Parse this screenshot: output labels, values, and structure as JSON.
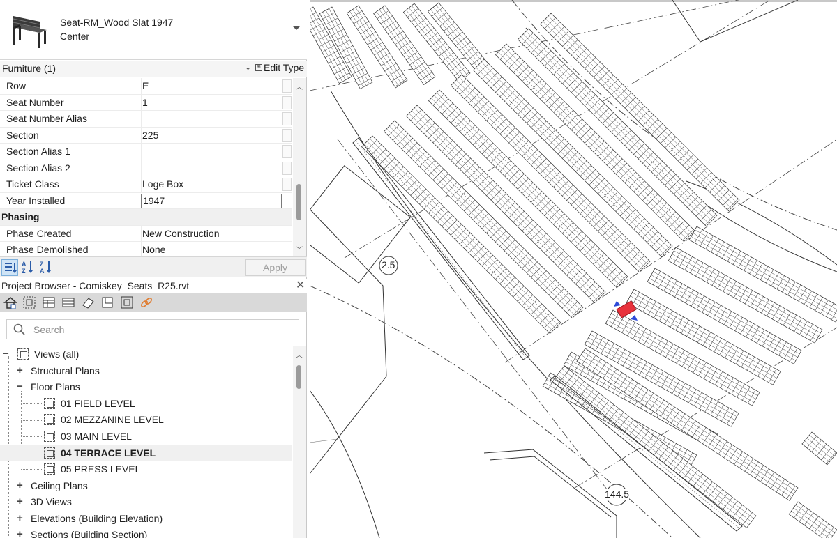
{
  "type_selector": {
    "family": "Seat-RM_Wood Slat 1947",
    "type": "Center"
  },
  "filter": {
    "label": "Furniture (1)",
    "edit_type": "Edit Type"
  },
  "properties": [
    {
      "name": "Row",
      "value": "E"
    },
    {
      "name": "Seat Number",
      "value": "1"
    },
    {
      "name": "Seat Number Alias",
      "value": ""
    },
    {
      "name": "Section",
      "value": "225"
    },
    {
      "name": "Section Alias 1",
      "value": ""
    },
    {
      "name": "Section Alias 2",
      "value": ""
    },
    {
      "name": "Ticket Class",
      "value": "Loge Box"
    },
    {
      "name": "Year Installed",
      "value": "1947"
    }
  ],
  "phasing": {
    "group_label": "Phasing",
    "rows": [
      {
        "name": "Phase Created",
        "value": "New Construction"
      },
      {
        "name": "Phase Demolished",
        "value": "None"
      }
    ]
  },
  "props_toolbar": {
    "apply": "Apply"
  },
  "project_browser": {
    "title": "Project Browser - Comiskey_Seats_R25.rvt",
    "search_placeholder": "Search",
    "tree": {
      "root": "Views (all)",
      "structural_plans": "Structural Plans",
      "floor_plans": "Floor Plans",
      "floor_plan_items": [
        "01 FIELD LEVEL",
        "02 MEZZANINE LEVEL",
        "03 MAIN LEVEL",
        "04 TERRACE LEVEL",
        "05 PRESS LEVEL"
      ],
      "ceiling_plans": "Ceiling Plans",
      "views_3d": "3D Views",
      "elevations": "Elevations (Building Elevation)",
      "sections": "Sections (Building Section)"
    }
  },
  "canvas": {
    "grid_tag_1": "2.5",
    "grid_tag_2": "144.5",
    "selection_color": "#e8323c"
  }
}
